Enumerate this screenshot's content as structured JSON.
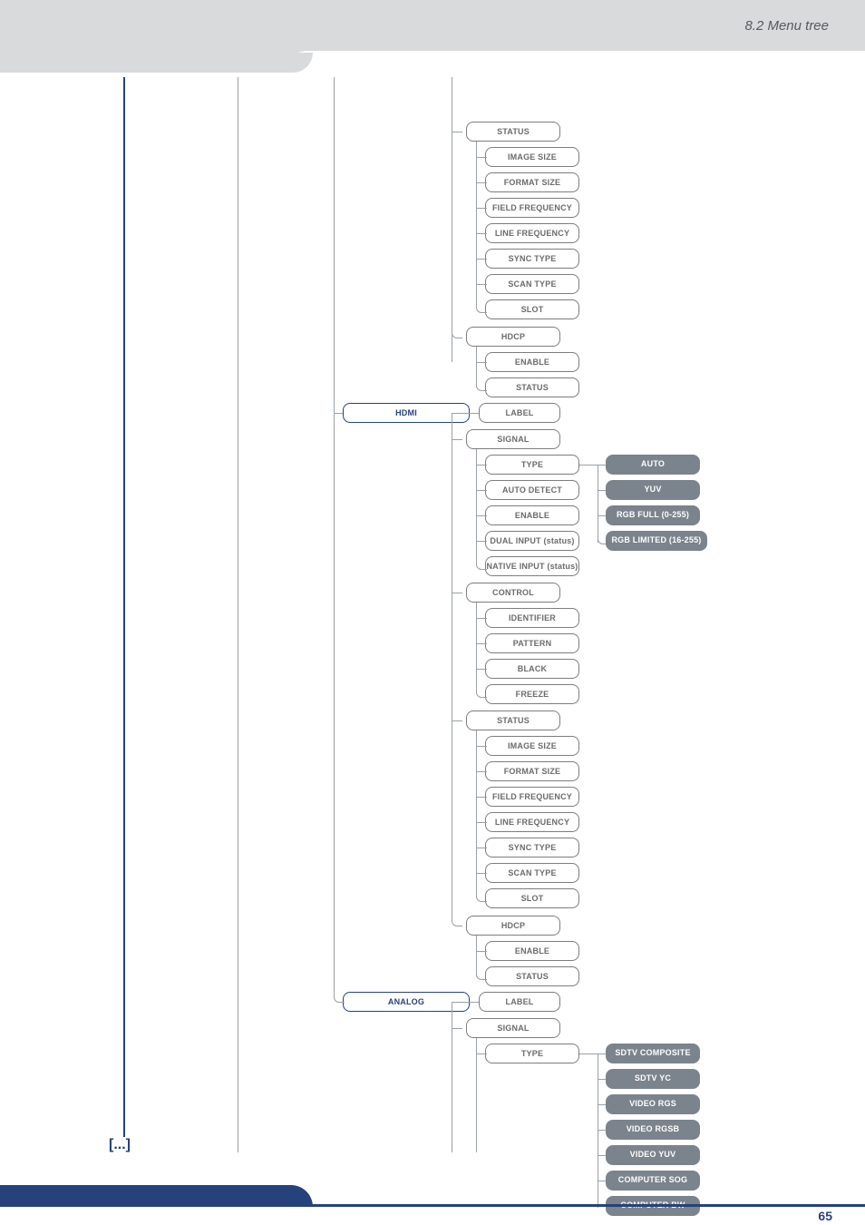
{
  "header": {
    "section_title": "8.2 Menu tree"
  },
  "footer": {
    "page_number": "65"
  },
  "continues_marker": "[...]",
  "tree": {
    "col2": {
      "hdmi": "HDMI",
      "analog": "ANALOG"
    },
    "col3": {
      "status1": "STATUS",
      "hdcp1": "HDCP",
      "label1": "LABEL",
      "signal1": "SIGNAL",
      "control": "CONTROL",
      "status2": "STATUS",
      "hdcp2": "HDCP",
      "label2": "LABEL",
      "signal2": "SIGNAL"
    },
    "status_children": [
      "IMAGE SIZE",
      "FORMAT SIZE",
      "FIELD FREQUENCY",
      "LINE FREQUENCY",
      "SYNC TYPE",
      "SCAN TYPE",
      "SLOT"
    ],
    "hdcp_children": [
      "ENABLE",
      "STATUS"
    ],
    "signal1_children": [
      "TYPE",
      "AUTO DETECT",
      "ENABLE",
      "DUAL INPUT (status)",
      "NATIVE INPUT (status)"
    ],
    "signal1_type_children": [
      "AUTO",
      "YUV",
      "RGB FULL (0-255)",
      "RGB LIMITED (16-255)"
    ],
    "control_children": [
      "IDENTIFIER",
      "PATTERN",
      "BLACK",
      "FREEZE"
    ],
    "signal2_children": [
      "TYPE"
    ],
    "signal2_type_children": [
      "SDTV COMPOSITE",
      "SDTV YC",
      "VIDEO RGS",
      "VIDEO RGSB",
      "VIDEO YUV",
      "COMPUTER SOG",
      "COMPUTER BW"
    ]
  }
}
